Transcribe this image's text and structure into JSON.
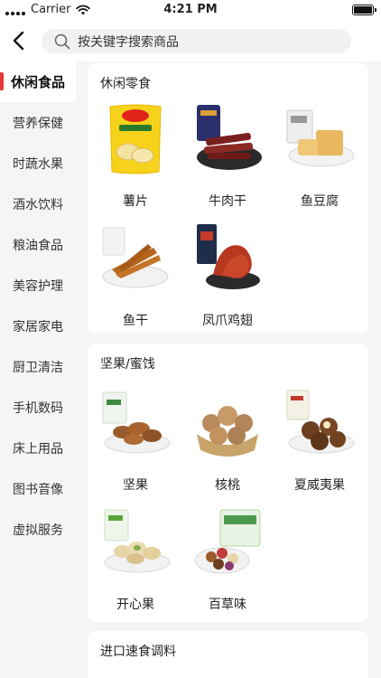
{
  "status_bar": {
    "carrier": "Carrier",
    "time": "4:21 PM"
  },
  "search": {
    "placeholder": "按关键字搜索商品"
  },
  "sidebar": {
    "items": [
      {
        "label": "休闲食品",
        "active": true
      },
      {
        "label": "营养保健"
      },
      {
        "label": "时蔬水果"
      },
      {
        "label": "酒水饮料"
      },
      {
        "label": "粮油食品"
      },
      {
        "label": "美容护理"
      },
      {
        "label": "家居家电"
      },
      {
        "label": "厨卫清洁"
      },
      {
        "label": "手机数码"
      },
      {
        "label": "床上用品"
      },
      {
        "label": "图书音像"
      },
      {
        "label": "虚拟服务"
      }
    ]
  },
  "sections": [
    {
      "title": "休闲零食",
      "products": [
        {
          "label": "薯片",
          "icon": "chips-bag-icon"
        },
        {
          "label": "牛肉干",
          "icon": "beef-jerky-icon"
        },
        {
          "label": "鱼豆腐",
          "icon": "fish-tofu-icon"
        },
        {
          "label": "鱼干",
          "icon": "dried-fish-icon"
        },
        {
          "label": "凤爪鸡翅",
          "icon": "chicken-feet-icon"
        }
      ]
    },
    {
      "title": "坚果/蜜饯",
      "products": [
        {
          "label": "坚果",
          "icon": "pecan-icon"
        },
        {
          "label": "核桃",
          "icon": "walnut-icon"
        },
        {
          "label": "夏威夷果",
          "icon": "macadamia-icon"
        },
        {
          "label": "开心果",
          "icon": "pistachio-icon"
        },
        {
          "label": "百草味",
          "icon": "mixed-nuts-icon"
        }
      ]
    },
    {
      "title": "进口速食调料",
      "products": []
    }
  ],
  "colors": {
    "accent": "#e53935",
    "page_bg": "#f5f5f5",
    "card_bg": "#ffffff",
    "search_bg": "#f1f1f3"
  }
}
